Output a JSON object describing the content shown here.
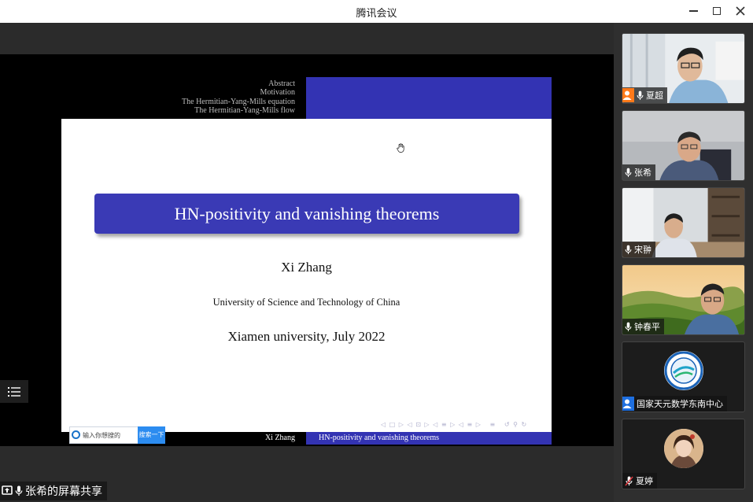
{
  "window": {
    "title": "腾讯会议"
  },
  "slide": {
    "nav_items": [
      "Abstract",
      "Motivation",
      "The Hermitian-Yang-Mills equation",
      "The Hermitian-Yang-Mills flow"
    ],
    "title": "HN-positivity and vanishing theorems",
    "author": "Xi Zhang",
    "affiliation": "University of Science and Technology of China",
    "venue": "Xiamen university, July 2022",
    "footer_author": "Xi Zhang",
    "footer_title": "HN-positivity and vanishing theorems"
  },
  "search": {
    "placeholder": "输入你想搜的",
    "button": "搜索一下"
  },
  "share": {
    "label": "张希的屏幕共享"
  },
  "participants": [
    {
      "name": "夏超",
      "host": true
    },
    {
      "name": "张希",
      "host": false
    },
    {
      "name": "宋翀",
      "host": false
    },
    {
      "name": "钟春平",
      "host": false
    },
    {
      "name": "国家天元数学东南中心",
      "host": false
    },
    {
      "name": "夏婷",
      "host": false
    }
  ],
  "colors": {
    "beamer_blue": "#3333b3",
    "host_badge": "#ff7a1a",
    "org_badge": "#1e6fe0"
  }
}
